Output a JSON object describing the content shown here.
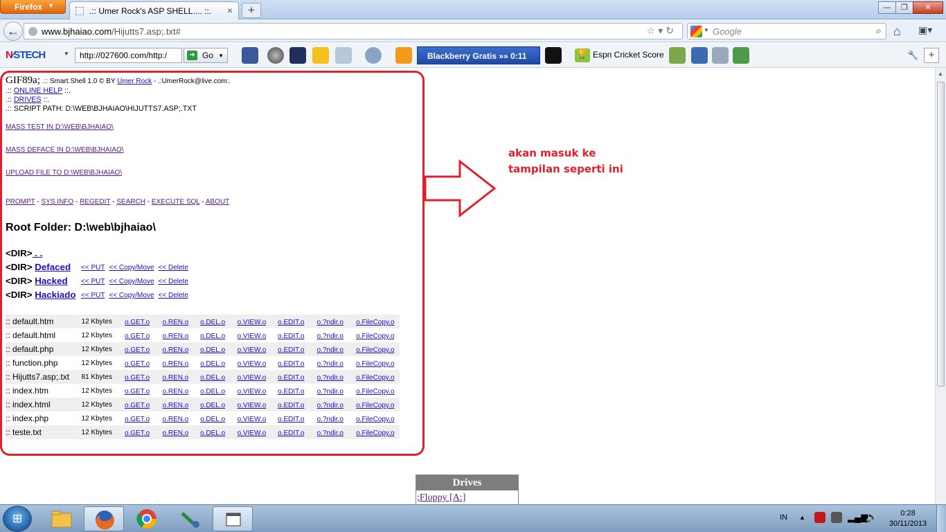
{
  "browser": {
    "menu_button": "Firefox",
    "tab_title": ".:: Umer Rock's ASP SHELL.... ::.",
    "address_host": "www.bjhaiao.com",
    "address_path": "/Hijutts7.asp;.txt#",
    "search_placeholder": "Google"
  },
  "toolbar": {
    "logo_first": "N",
    "logo_rest": "∕STECH",
    "url_value": "http://027600.com/http:/",
    "go_label": "Go",
    "blackberry_label": "Blackberry Gratis »»  0:11",
    "espn_label": "Espn Cricket Score"
  },
  "shell": {
    "header_gif": "GIF89a;",
    "header_rest": " .:: Smart.Shell 1.0 © BY ",
    "author": "Umer Rock",
    "email": " - .:UmerRock@live.com:.",
    "help_link": "ONLINE HELP",
    "drives_link": "DRIVES",
    "script_path": ".:: SCRIPT PATH: D:\\WEB\\BJHAIAO\\HIJUTTS7.ASP;.TXT",
    "mass_test": "MASS TEST IN D:\\WEB\\BJHAIAO\\",
    "mass_deface": "MASS DEFACE IN D:\\WEB\\BJHAIAO\\",
    "upload": "UPLOAD FILE TO D:\\WEB\\BJHAIAO\\",
    "menu": [
      "PROMPT",
      "SYS INFO",
      "REGEDIT",
      "SEARCH",
      "EXECUTE SQL",
      "ABOUT"
    ],
    "root_folder": "Root Folder: D:\\web\\bjhaiao\\",
    "dir_prefix": "<DIR>",
    "parent_dir": " . .",
    "dirs": [
      "Defaced",
      "Hacked",
      "Hackiado"
    ],
    "dir_actions": [
      "<< PUT",
      "<< Copy/Move",
      "<< Delete"
    ],
    "file_actions": [
      "o.GET.o",
      "o.REN.o",
      "o.DEL.o",
      "o.VIEW.o",
      "o.EDIT.o",
      "o.?ndir.o",
      "o.FileCopy.o"
    ],
    "files": [
      {
        "name": ":: default.htm",
        "size": "12 Kbytes"
      },
      {
        "name": ":: default.html",
        "size": "12 Kbytes"
      },
      {
        "name": ":: default.php",
        "size": "12 Kbytes"
      },
      {
        "name": ":: function.php",
        "size": "12 Kbytes"
      },
      {
        "name": ":: Hijutts7.asp;.txt",
        "size": "81 Kbytes"
      },
      {
        "name": ":: index.htm",
        "size": "12 Kbytes"
      },
      {
        "name": ":: index.html",
        "size": "12 Kbytes"
      },
      {
        "name": ":: index.php",
        "size": "12 Kbytes"
      },
      {
        "name": ":: teste.txt",
        "size": "12 Kbytes"
      }
    ]
  },
  "annotation": {
    "line1": "akan masuk ke",
    "line2": "tampilan seperti ini",
    "color": "#e0202a"
  },
  "drives_panel": {
    "title": "Drives",
    "first_drive": ";Floppy [A:]"
  },
  "taskbar": {
    "language": "IN",
    "time": "0:28",
    "date": "30/11/2013"
  }
}
